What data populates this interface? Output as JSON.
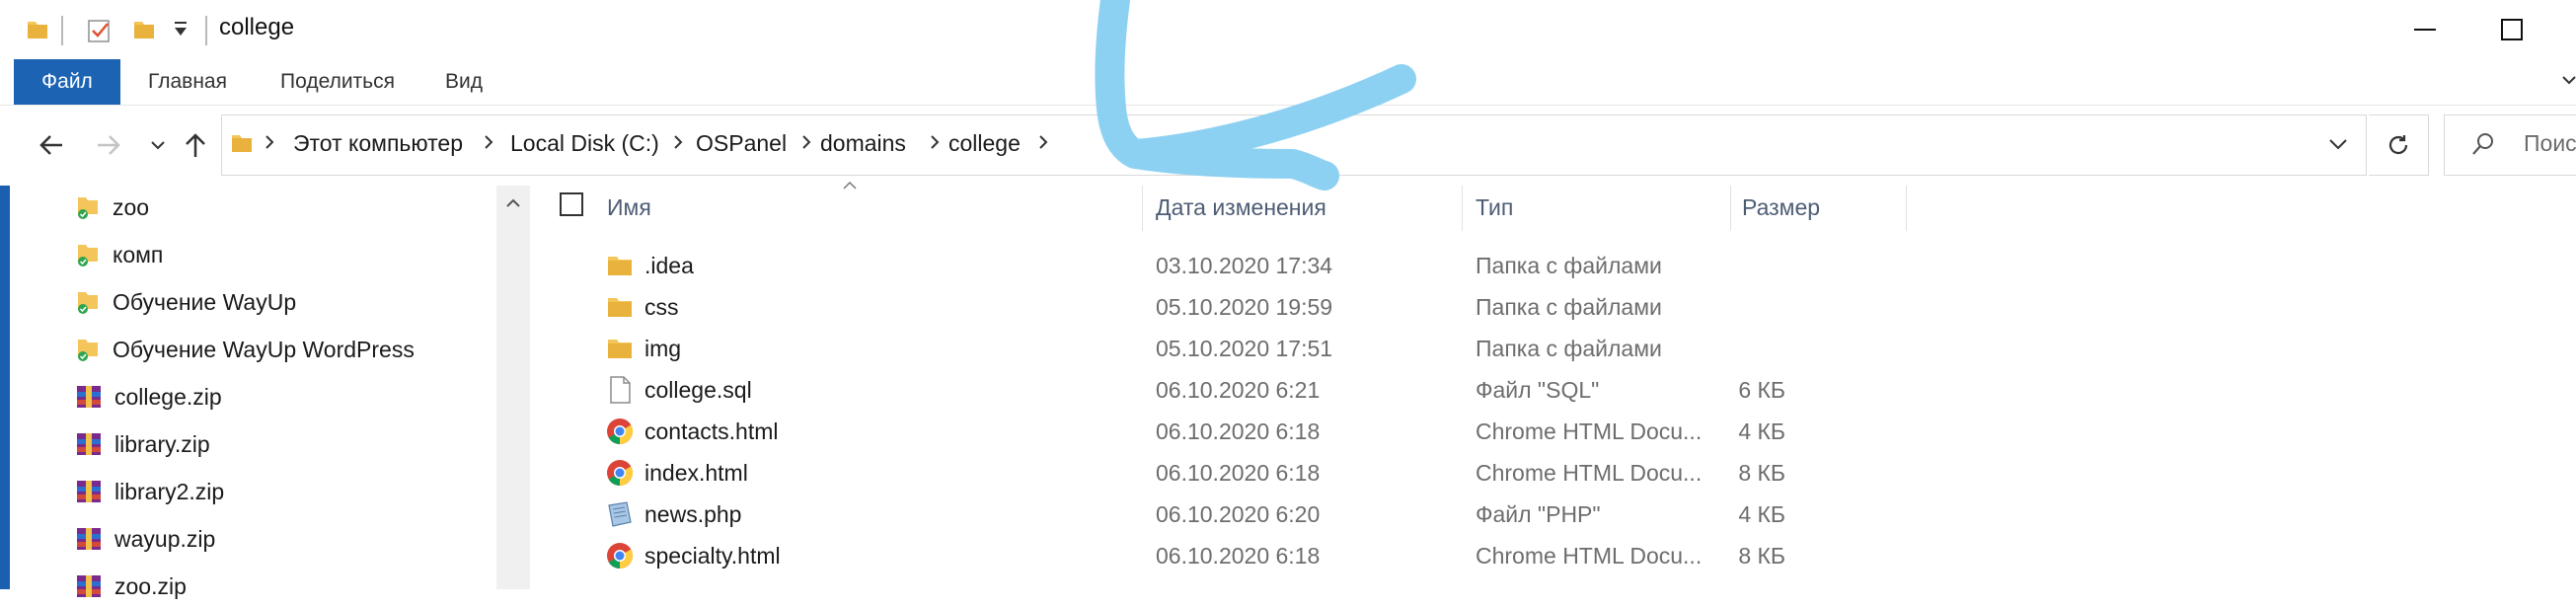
{
  "window": {
    "title": "college"
  },
  "ribbon": {
    "tabs": [
      "Файл",
      "Главная",
      "Поделиться",
      "Вид"
    ]
  },
  "address": {
    "crumbs": [
      "Этот компьютер",
      "Local Disk (C:)",
      "OSPanel",
      "domains",
      "college"
    ]
  },
  "search": {
    "placeholder": "Поис"
  },
  "nav_pane": {
    "items": [
      {
        "label": "zoo",
        "icon": "synced-folder-icon"
      },
      {
        "label": "комп",
        "icon": "synced-folder-icon"
      },
      {
        "label": "Обучение WayUp",
        "icon": "synced-folder-icon"
      },
      {
        "label": "Обучение WayUp WordPress",
        "icon": "synced-folder-icon"
      },
      {
        "label": "college.zip",
        "icon": "zip-archive-icon"
      },
      {
        "label": "library.zip",
        "icon": "zip-archive-icon"
      },
      {
        "label": "library2.zip",
        "icon": "zip-archive-icon"
      },
      {
        "label": "wayup.zip",
        "icon": "zip-archive-icon"
      },
      {
        "label": "zoo.zip",
        "icon": "zip-archive-icon"
      }
    ]
  },
  "columns": {
    "name": "Имя",
    "date": "Дата изменения",
    "type": "Тип",
    "size": "Размер"
  },
  "files": [
    {
      "name": ".idea",
      "date": "03.10.2020 17:34",
      "type": "Папка с файлами",
      "size": "",
      "icon": "folder-icon"
    },
    {
      "name": "css",
      "date": "05.10.2020 19:59",
      "type": "Папка с файлами",
      "size": "",
      "icon": "folder-icon"
    },
    {
      "name": "img",
      "date": "05.10.2020 17:51",
      "type": "Папка с файлами",
      "size": "",
      "icon": "folder-icon"
    },
    {
      "name": "college.sql",
      "date": "06.10.2020 6:21",
      "type": "Файл \"SQL\"",
      "size": "6 КБ",
      "icon": "document-icon"
    },
    {
      "name": "contacts.html",
      "date": "06.10.2020 6:18",
      "type": "Chrome HTML Docu...",
      "size": "4 КБ",
      "icon": "chrome-icon"
    },
    {
      "name": "index.html",
      "date": "06.10.2020 6:18",
      "type": "Chrome HTML Docu...",
      "size": "8 КБ",
      "icon": "chrome-icon"
    },
    {
      "name": "news.php",
      "date": "06.10.2020 6:20",
      "type": "Файл \"PHP\"",
      "size": "4 КБ",
      "icon": "php-file-icon"
    },
    {
      "name": "specialty.html",
      "date": "06.10.2020 6:18",
      "type": "Chrome HTML Docu...",
      "size": "8 КБ",
      "icon": "chrome-icon"
    }
  ],
  "colors": {
    "accent": "#1c64b3",
    "folder": "#f3c55a",
    "annotation": "#87cff1"
  }
}
